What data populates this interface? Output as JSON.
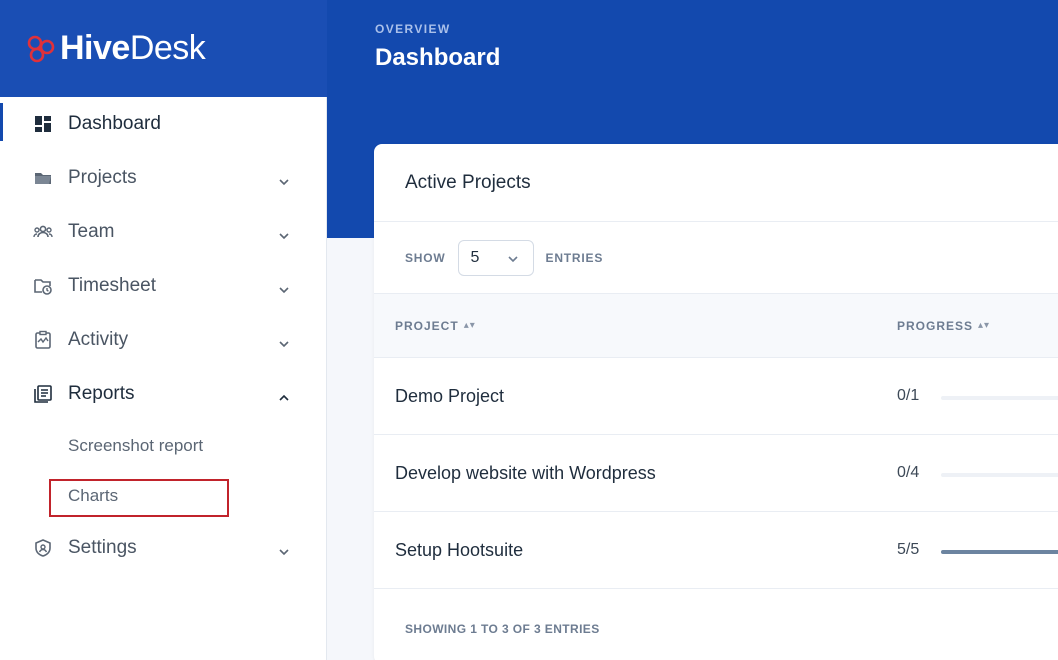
{
  "brand": {
    "name_bold": "Hive",
    "name_light": "Desk",
    "accent": "#e0313a"
  },
  "header": {
    "eyebrow": "OVERVIEW",
    "title": "Dashboard"
  },
  "sidebar": {
    "items": [
      {
        "label": "Dashboard",
        "icon": "dashboard-icon",
        "active": true
      },
      {
        "label": "Projects",
        "icon": "folder-icon"
      },
      {
        "label": "Team",
        "icon": "team-icon"
      },
      {
        "label": "Timesheet",
        "icon": "timesheet-icon"
      },
      {
        "label": "Activity",
        "icon": "activity-icon"
      },
      {
        "label": "Reports",
        "icon": "reports-icon",
        "expanded": true
      },
      {
        "label": "Settings",
        "icon": "shield-icon"
      }
    ],
    "report_subitems": [
      "Screenshot report",
      "Charts"
    ]
  },
  "card": {
    "title": "Active Projects",
    "show_label": "SHOW",
    "entries_value": "5",
    "entries_label": "ENTRIES",
    "columns": {
      "project": "PROJECT",
      "progress": "PROGRESS"
    },
    "rows": [
      {
        "name": "Demo Project",
        "progress_text": "0/1",
        "fraction": 0
      },
      {
        "name": "Develop website with Wordpress",
        "progress_text": "0/4",
        "fraction": 0
      },
      {
        "name": "Setup Hootsuite",
        "progress_text": "5/5",
        "fraction": 1
      }
    ],
    "footer": "SHOWING 1 TO 3 OF 3 ENTRIES"
  },
  "colors": {
    "primary": "#1349ae",
    "highlight_box": "#c1232b"
  }
}
